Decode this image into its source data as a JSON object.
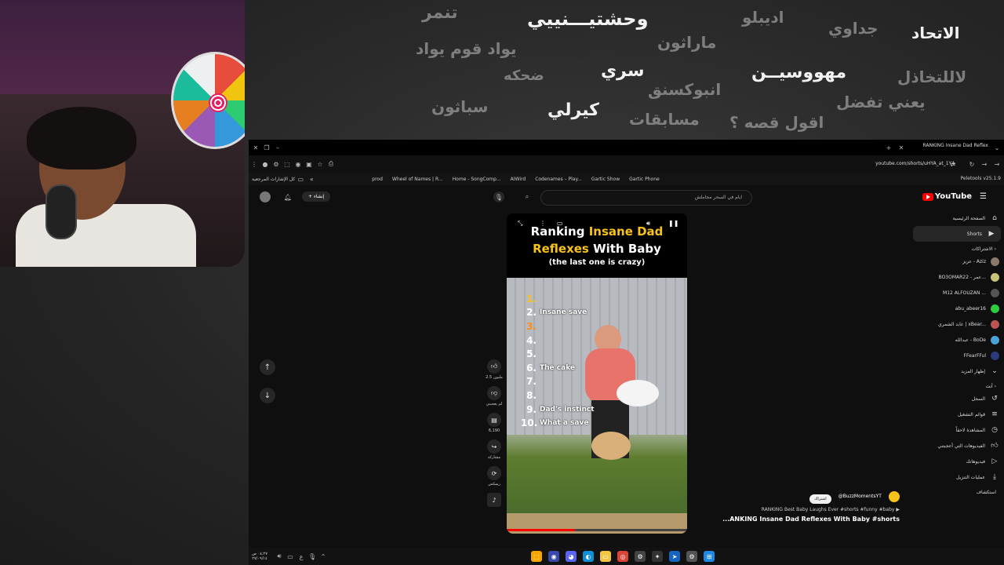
{
  "overlay_words": {
    "w1": "تنمر",
    "w2": "وحشتيـــنييي",
    "w3": "اديبلو",
    "w4": "جداوي",
    "w5": "الاتحاد",
    "w6": "يواد قوم يواد",
    "w7": "ماراثون",
    "w8": "ضحكه",
    "w9": "سري",
    "w10": "مهووسيــن",
    "w11": "لاللتخاذل",
    "w12": "انبوكسنق",
    "w13": "يعني تفضل",
    "w14": "سباثون",
    "w15": "كيرلي",
    "w16": "مسابقات",
    "w17": "اقول قصه ؟"
  },
  "browser": {
    "tab_title": "RANKING Insane Dad Reflex",
    "url": "youtube.com/shorts/uHYA_at_1Y4",
    "extension_label": "Peletools v25.1.9",
    "bookmarks": [
      "prod",
      "Wheel of Names | R...",
      "Home - SongComp...",
      "AIWird",
      "Codenames – Play...",
      "Gartic Show",
      "Gartic Phone"
    ],
    "all_bookmarks": "كل الإشارات المرجعية"
  },
  "youtube": {
    "logo_text": "YouTube",
    "search_value": "ايام في السحر مجاملش",
    "create_label": "إنشاء",
    "sidebar": {
      "home": "الصفحة الرئيسية",
      "shorts": "Shorts",
      "subs_header": "الاشتراكات",
      "channels": [
        "عزيز - Aziz",
        "BO3OMAR22 - عمر...",
        "M12 ALFOUZAN ...",
        "abu_abeer16",
        "عابد الشمري | xBear...",
        "عبدالله - BoDe",
        "FFearFFul"
      ],
      "show_more": "إظهار المزيد",
      "you_header": "أنت",
      "history": "السجل",
      "playlists": "قوائم التشغيل",
      "watch_later": "المشاهدة لاحقاً",
      "liked": "الفيديوهات التي أعجبتني",
      "your_videos": "فيديوهاتك",
      "downloads": "عمليات التنزيل",
      "explore": "استكشاف"
    },
    "short": {
      "title_line1_a": "Ranking ",
      "title_line1_b": "Insane Dad",
      "title_line2_a": "Reflexes ",
      "title_line2_b": "With Baby",
      "subtitle": "(the last one is crazy)",
      "ranks": [
        {
          "n": "1.",
          "t": ""
        },
        {
          "n": "2.",
          "t": "Insane save"
        },
        {
          "n": "3.",
          "t": ""
        },
        {
          "n": "4.",
          "t": ""
        },
        {
          "n": "5.",
          "t": ""
        },
        {
          "n": "6.",
          "t": "The cake"
        },
        {
          "n": "7.",
          "t": ""
        },
        {
          "n": "8.",
          "t": ""
        },
        {
          "n": "9.",
          "t": "Dad's instinct"
        },
        {
          "n": "10.",
          "t": "What a save"
        }
      ],
      "progress": 0.38
    },
    "actions": {
      "likes": "2.5 مليون",
      "dislike": "لم يعجبني",
      "comments": "6,190",
      "share": "مشاركة",
      "remix": "ريمكس"
    },
    "channel": {
      "subscribe": "اشتراك",
      "handle": "@BuzzMomentsYT",
      "sound": "RANKING Best Baby Laughs Ever #shorts #funny #baby",
      "title": "...ANKING Insane Dad Reflexes With Baby #shorts"
    }
  },
  "taskbar": {
    "time": "٠٤:٢٧ ص",
    "date": "٢٧/٠٩/١٤"
  }
}
